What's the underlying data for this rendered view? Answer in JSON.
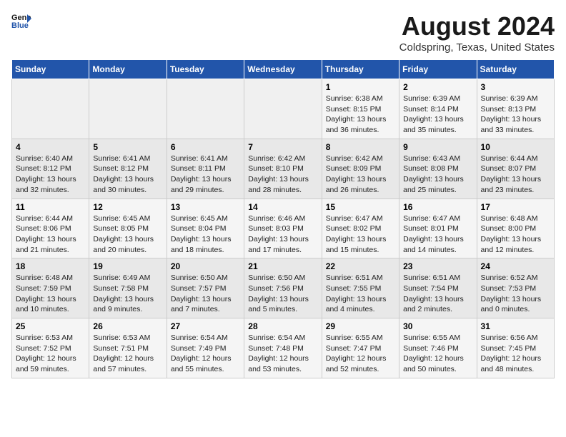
{
  "header": {
    "logo_line1": "General",
    "logo_line2": "Blue",
    "month_year": "August 2024",
    "location": "Coldspring, Texas, United States"
  },
  "weekdays": [
    "Sunday",
    "Monday",
    "Tuesday",
    "Wednesday",
    "Thursday",
    "Friday",
    "Saturday"
  ],
  "weeks": [
    [
      {
        "day": "",
        "info": ""
      },
      {
        "day": "",
        "info": ""
      },
      {
        "day": "",
        "info": ""
      },
      {
        "day": "",
        "info": ""
      },
      {
        "day": "1",
        "info": "Sunrise: 6:38 AM\nSunset: 8:15 PM\nDaylight: 13 hours\nand 36 minutes."
      },
      {
        "day": "2",
        "info": "Sunrise: 6:39 AM\nSunset: 8:14 PM\nDaylight: 13 hours\nand 35 minutes."
      },
      {
        "day": "3",
        "info": "Sunrise: 6:39 AM\nSunset: 8:13 PM\nDaylight: 13 hours\nand 33 minutes."
      }
    ],
    [
      {
        "day": "4",
        "info": "Sunrise: 6:40 AM\nSunset: 8:12 PM\nDaylight: 13 hours\nand 32 minutes."
      },
      {
        "day": "5",
        "info": "Sunrise: 6:41 AM\nSunset: 8:12 PM\nDaylight: 13 hours\nand 30 minutes."
      },
      {
        "day": "6",
        "info": "Sunrise: 6:41 AM\nSunset: 8:11 PM\nDaylight: 13 hours\nand 29 minutes."
      },
      {
        "day": "7",
        "info": "Sunrise: 6:42 AM\nSunset: 8:10 PM\nDaylight: 13 hours\nand 28 minutes."
      },
      {
        "day": "8",
        "info": "Sunrise: 6:42 AM\nSunset: 8:09 PM\nDaylight: 13 hours\nand 26 minutes."
      },
      {
        "day": "9",
        "info": "Sunrise: 6:43 AM\nSunset: 8:08 PM\nDaylight: 13 hours\nand 25 minutes."
      },
      {
        "day": "10",
        "info": "Sunrise: 6:44 AM\nSunset: 8:07 PM\nDaylight: 13 hours\nand 23 minutes."
      }
    ],
    [
      {
        "day": "11",
        "info": "Sunrise: 6:44 AM\nSunset: 8:06 PM\nDaylight: 13 hours\nand 21 minutes."
      },
      {
        "day": "12",
        "info": "Sunrise: 6:45 AM\nSunset: 8:05 PM\nDaylight: 13 hours\nand 20 minutes."
      },
      {
        "day": "13",
        "info": "Sunrise: 6:45 AM\nSunset: 8:04 PM\nDaylight: 13 hours\nand 18 minutes."
      },
      {
        "day": "14",
        "info": "Sunrise: 6:46 AM\nSunset: 8:03 PM\nDaylight: 13 hours\nand 17 minutes."
      },
      {
        "day": "15",
        "info": "Sunrise: 6:47 AM\nSunset: 8:02 PM\nDaylight: 13 hours\nand 15 minutes."
      },
      {
        "day": "16",
        "info": "Sunrise: 6:47 AM\nSunset: 8:01 PM\nDaylight: 13 hours\nand 14 minutes."
      },
      {
        "day": "17",
        "info": "Sunrise: 6:48 AM\nSunset: 8:00 PM\nDaylight: 13 hours\nand 12 minutes."
      }
    ],
    [
      {
        "day": "18",
        "info": "Sunrise: 6:48 AM\nSunset: 7:59 PM\nDaylight: 13 hours\nand 10 minutes."
      },
      {
        "day": "19",
        "info": "Sunrise: 6:49 AM\nSunset: 7:58 PM\nDaylight: 13 hours\nand 9 minutes."
      },
      {
        "day": "20",
        "info": "Sunrise: 6:50 AM\nSunset: 7:57 PM\nDaylight: 13 hours\nand 7 minutes."
      },
      {
        "day": "21",
        "info": "Sunrise: 6:50 AM\nSunset: 7:56 PM\nDaylight: 13 hours\nand 5 minutes."
      },
      {
        "day": "22",
        "info": "Sunrise: 6:51 AM\nSunset: 7:55 PM\nDaylight: 13 hours\nand 4 minutes."
      },
      {
        "day": "23",
        "info": "Sunrise: 6:51 AM\nSunset: 7:54 PM\nDaylight: 13 hours\nand 2 minutes."
      },
      {
        "day": "24",
        "info": "Sunrise: 6:52 AM\nSunset: 7:53 PM\nDaylight: 13 hours\nand 0 minutes."
      }
    ],
    [
      {
        "day": "25",
        "info": "Sunrise: 6:53 AM\nSunset: 7:52 PM\nDaylight: 12 hours\nand 59 minutes."
      },
      {
        "day": "26",
        "info": "Sunrise: 6:53 AM\nSunset: 7:51 PM\nDaylight: 12 hours\nand 57 minutes."
      },
      {
        "day": "27",
        "info": "Sunrise: 6:54 AM\nSunset: 7:49 PM\nDaylight: 12 hours\nand 55 minutes."
      },
      {
        "day": "28",
        "info": "Sunrise: 6:54 AM\nSunset: 7:48 PM\nDaylight: 12 hours\nand 53 minutes."
      },
      {
        "day": "29",
        "info": "Sunrise: 6:55 AM\nSunset: 7:47 PM\nDaylight: 12 hours\nand 52 minutes."
      },
      {
        "day": "30",
        "info": "Sunrise: 6:55 AM\nSunset: 7:46 PM\nDaylight: 12 hours\nand 50 minutes."
      },
      {
        "day": "31",
        "info": "Sunrise: 6:56 AM\nSunset: 7:45 PM\nDaylight: 12 hours\nand 48 minutes."
      }
    ]
  ]
}
